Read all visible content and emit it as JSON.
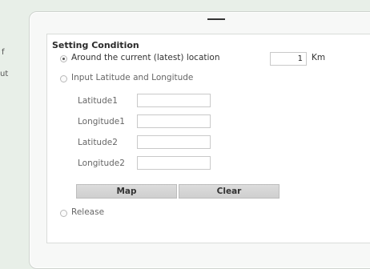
{
  "edge": {
    "left_text_1": "f",
    "left_text_2": "ut"
  },
  "panel": {
    "title": "Setting Condition",
    "options": {
      "current_location": {
        "label": "Around the current (latest) location",
        "selected": true,
        "value": "1",
        "unit": "Km"
      },
      "input_latlon": {
        "label": "Input Latitude and Longitude",
        "selected": false
      },
      "release": {
        "label": "Release",
        "selected": false
      }
    },
    "fields": [
      {
        "label": "Latitude1",
        "value": ""
      },
      {
        "label": "Longitude1",
        "value": ""
      },
      {
        "label": "Latitude2",
        "value": ""
      },
      {
        "label": "Longitude2",
        "value": ""
      }
    ],
    "buttons": {
      "map": "Map",
      "clear": "Clear"
    }
  }
}
